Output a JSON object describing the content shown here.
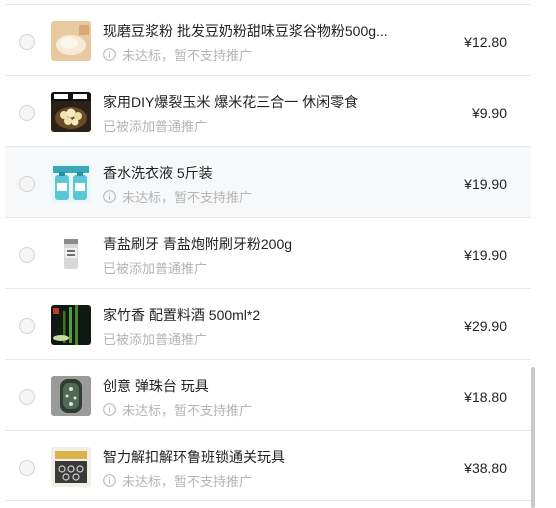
{
  "items": [
    {
      "title": "现磨豆浆粉 批发豆奶粉甜味豆浆谷物粉500g...",
      "status": "未达标，暂不支持推广",
      "has_info_icon": true,
      "price": "¥12.80",
      "thumb": "soy-powder-image"
    },
    {
      "title": "家用DIY爆裂玉米 爆米花三合一 休闲零食",
      "status": "已被添加普通推广",
      "has_info_icon": false,
      "price": "¥9.90",
      "thumb": "popcorn-image"
    },
    {
      "title": "香水洗衣液 5斤装",
      "status": "未达标，暂不支持推广",
      "has_info_icon": true,
      "price": "¥19.90",
      "thumb": "detergent-image"
    },
    {
      "title": "青盐刷牙 青盐炮附刷牙粉200g",
      "status": "已被添加普通推广",
      "has_info_icon": false,
      "price": "¥19.90",
      "thumb": "tooth-powder-image"
    },
    {
      "title": "家竹香 配置料酒 500ml*2",
      "status": "已被添加普通推广",
      "has_info_icon": false,
      "price": "¥29.90",
      "thumb": "cooking-wine-image"
    },
    {
      "title": "创意 弹珠台 玩具",
      "status": "未达标，暂不支持推广",
      "has_info_icon": true,
      "price": "¥18.80",
      "thumb": "pinball-toy-image"
    },
    {
      "title": "智力解扣解环鲁班锁通关玩具",
      "status": "未达标，暂不支持推广",
      "has_info_icon": true,
      "price": "¥38.80",
      "thumb": "puzzle-toy-image"
    }
  ],
  "colors": {
    "status_text": "#b4b4b4",
    "highlight_row": "#f7f8fa",
    "divider": "#e6e6e6"
  }
}
